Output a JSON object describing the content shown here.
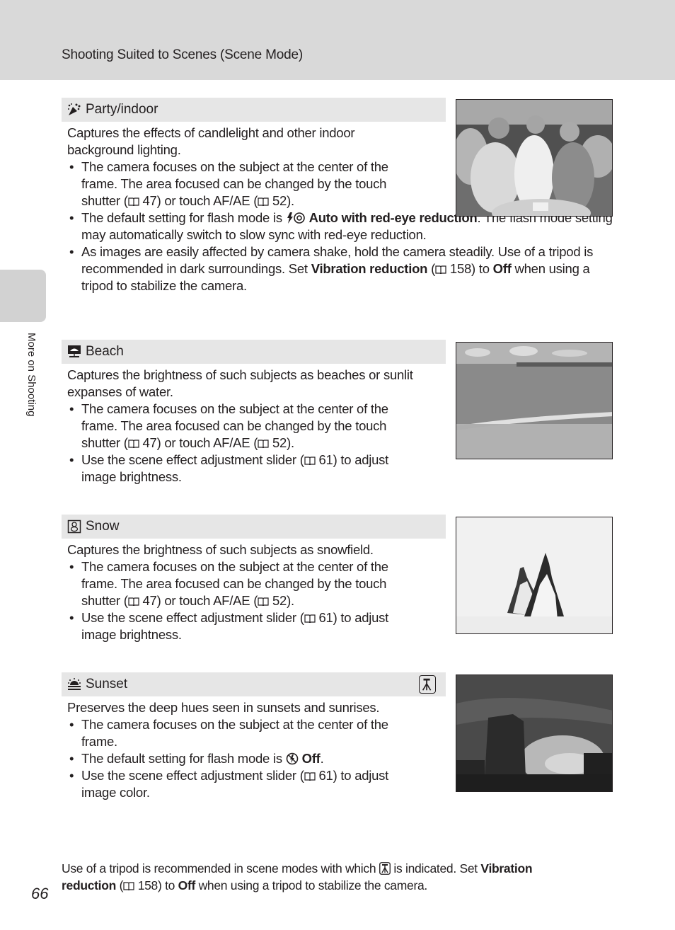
{
  "header": {
    "title": "Shooting Suited to Scenes (Scene Mode)"
  },
  "side_tab": {
    "label": "More on Shooting"
  },
  "sections": [
    {
      "icon": "party-indoor-icon",
      "title": "Party/indoor",
      "description": "Captures the effects of candlelight and other indoor background lighting.",
      "bullets": [
        {
          "pre": "The camera focuses on the subject at the center of the frame. The area focused can be changed by the touch shutter (",
          "ref1": "47",
          "mid": ") or touch AF/AE (",
          "ref2": "52",
          "post": ")."
        },
        {
          "pre": "The default setting for flash mode is ",
          "bold": "Auto with red-eye reduction",
          "post": ". The flash mode setting may automatically switch to slow sync with red-eye reduction."
        },
        {
          "pre": "As images are easily affected by camera shake, hold the camera steadily. Use of a tripod is recommended in dark surroundings. Set ",
          "bold1": "Vibration reduction",
          "mid1": " (",
          "ref": "158",
          "mid2": ") to ",
          "bold2": "Off",
          "post": " when using a tripod to stabilize the camera."
        }
      ],
      "photo": "party-photo"
    },
    {
      "icon": "beach-icon",
      "title": "Beach",
      "description": "Captures the brightness of such subjects as beaches or sunlit expanses of water.",
      "bullets": [
        {
          "pre": "The camera focuses on the subject at the center of the frame. The area focused can be changed by the touch shutter (",
          "ref1": "47",
          "mid": ") or touch AF/AE (",
          "ref2": "52",
          "post": ")."
        },
        {
          "pre": "Use the scene effect adjustment slider (",
          "ref": "61",
          "post": ") to adjust image brightness."
        }
      ],
      "photo": "beach-photo"
    },
    {
      "icon": "snow-icon",
      "title": "Snow",
      "description": "Captures the brightness of such subjects as snowfield.",
      "bullets": [
        {
          "pre": "The camera focuses on the subject at the center of the frame. The area focused can be changed by the touch shutter (",
          "ref1": "47",
          "mid": ") or touch AF/AE (",
          "ref2": "52",
          "post": ")."
        },
        {
          "pre": "Use the scene effect adjustment slider (",
          "ref": "61",
          "post": ") to adjust image brightness."
        }
      ],
      "photo": "snow-photo"
    },
    {
      "icon": "sunset-icon",
      "title": "Sunset",
      "tripod_icon": "tripod-icon",
      "description": "Preserves the deep hues seen in sunsets and sunrises.",
      "bullets": [
        {
          "text": "The camera focuses on the subject at the center of the frame."
        },
        {
          "pre": "The default setting for flash mode is ",
          "bold": "Off",
          "post": "."
        },
        {
          "pre": "Use the scene effect adjustment slider (",
          "ref": "61",
          "post": ") to adjust image color."
        }
      ],
      "photo": "sunset-photo"
    }
  ],
  "footer": {
    "pre": "Use of a tripod is recommended in scene modes with which ",
    "mid": " is indicated. Set ",
    "bold1": "Vibration reduction",
    "mid2": " (",
    "ref": "158",
    "mid3": ") to ",
    "bold2": "Off",
    "post": " when using a tripod to stabilize the camera."
  },
  "page_number": "66"
}
